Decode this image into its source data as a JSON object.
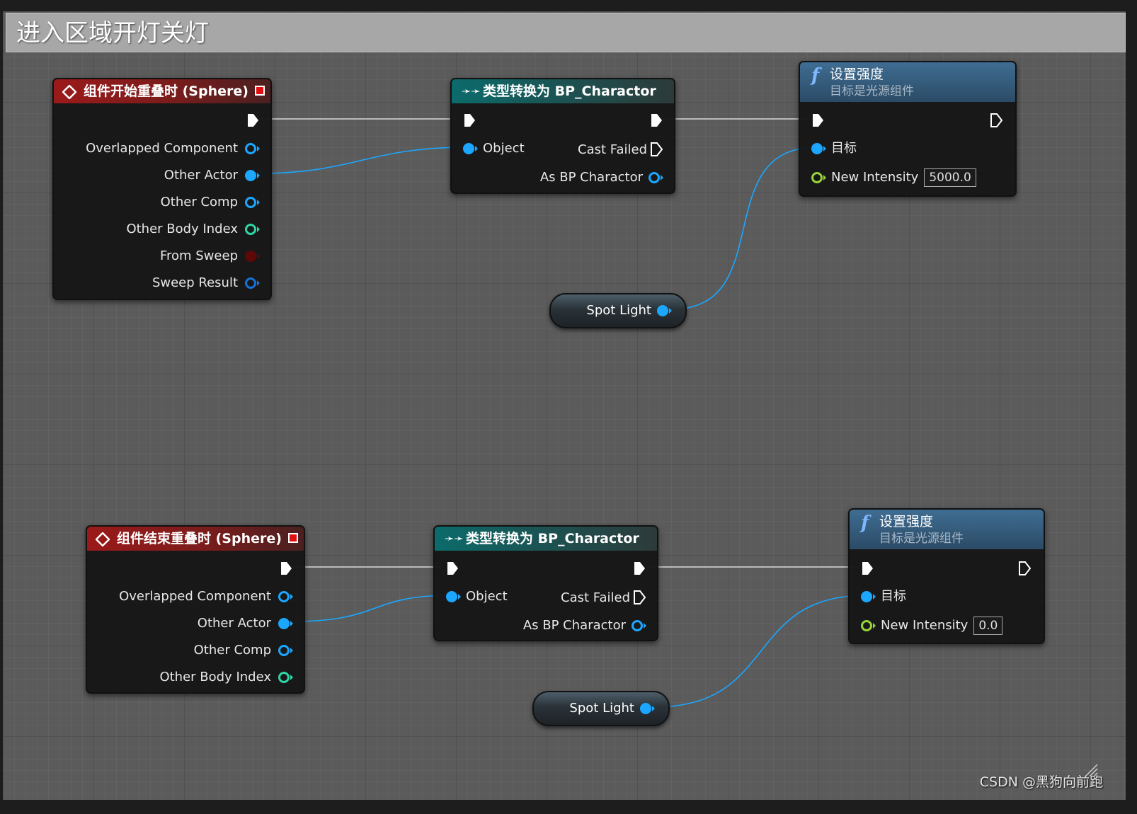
{
  "comment": {
    "title": "进入区域开灯关灯"
  },
  "top_row": {
    "event": {
      "title": "组件开始重叠时 (Sphere)",
      "pins": [
        "Overlapped Component",
        "Other Actor",
        "Other Comp",
        "Other Body Index",
        "From Sweep",
        "Sweep Result"
      ]
    },
    "cast": {
      "title": "类型转换为 BP_Charactor",
      "object_label": "Object",
      "cast_failed_label": "Cast Failed",
      "as_label": "As BP Charactor"
    },
    "func": {
      "title": "设置强度",
      "subtitle": "目标是光源组件",
      "target_label": "目标",
      "intensity_label": "New Intensity",
      "intensity_value": "5000.0"
    },
    "getter": {
      "label": "Spot Light"
    }
  },
  "bottom_row": {
    "event": {
      "title": "组件结束重叠时 (Sphere)",
      "pins": [
        "Overlapped Component",
        "Other Actor",
        "Other Comp",
        "Other Body Index"
      ]
    },
    "cast": {
      "title": "类型转换为 BP_Charactor",
      "object_label": "Object",
      "cast_failed_label": "Cast Failed",
      "as_label": "As BP Charactor"
    },
    "func": {
      "title": "设置强度",
      "subtitle": "目标是光源组件",
      "target_label": "目标",
      "intensity_label": "New Intensity",
      "intensity_value": "0.0"
    },
    "getter": {
      "label": "Spot Light"
    }
  },
  "watermark": "CSDN @黑狗向前跑",
  "colors": {
    "object_pin": "#1ba7ff",
    "int_pin": "#2fd6a6",
    "float_pin": "#96d43a",
    "bool_pin": "#7a0c0c",
    "struct_pin": "#1672d8",
    "exec_wire": "#d9d9d9",
    "object_wire": "#1ba7ff"
  },
  "icons": {
    "event": "event-diamond-icon",
    "delegate": "delegate-square-icon",
    "cast": "cast-arrows-icon",
    "function": "function-f-icon",
    "exec": "exec-arrow-icon"
  }
}
